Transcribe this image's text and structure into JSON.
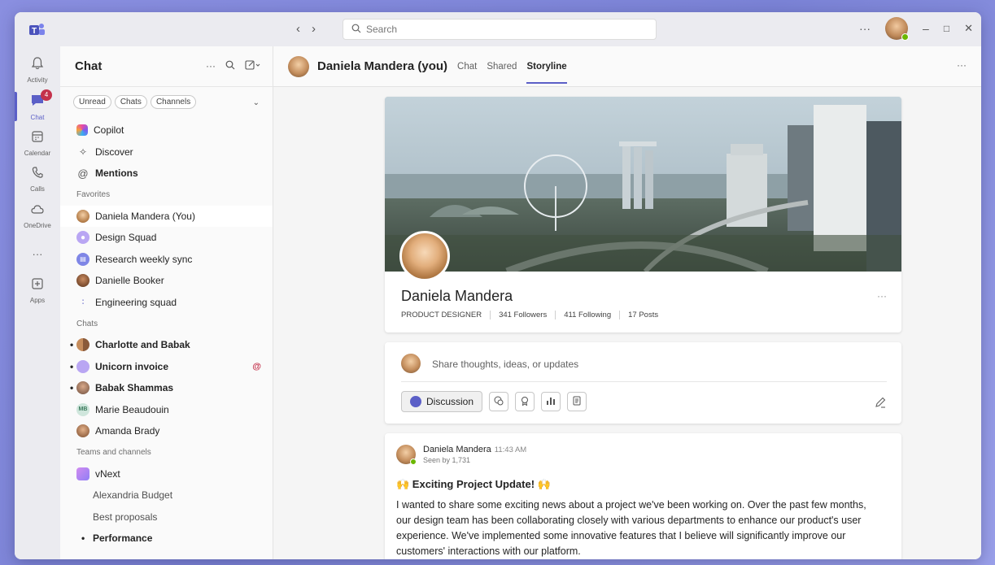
{
  "titlebar": {
    "search_placeholder": "Search",
    "more": "···",
    "minimize": "–",
    "maximize": "□",
    "close": "✕"
  },
  "rail": {
    "items": [
      {
        "label": "Activity",
        "icon": "bell-icon"
      },
      {
        "label": "Chat",
        "icon": "chat-icon",
        "badge": "4"
      },
      {
        "label": "Calendar",
        "icon": "calendar-icon"
      },
      {
        "label": "Calls",
        "icon": "phone-icon"
      },
      {
        "label": "OneDrive",
        "icon": "cloud-icon"
      },
      {
        "label": "",
        "icon": "more-icon"
      },
      {
        "label": "Apps",
        "icon": "apps-icon"
      }
    ]
  },
  "chatpane": {
    "title": "Chat",
    "filters": [
      "Unread",
      "Chats",
      "Channels"
    ],
    "top_items": [
      "Copilot",
      "Discover",
      "Mentions"
    ],
    "favorites_label": "Favorites",
    "favorites": [
      "Daniela Mandera (You)",
      "Design Squad",
      "Research weekly sync",
      "Danielle Booker",
      "Engineering squad"
    ],
    "chats_label": "Chats",
    "chats": [
      "Charlotte and Babak",
      "Unicorn invoice",
      "Babak Shammas",
      "Marie Beaudouin",
      "Amanda Brady"
    ],
    "chat_initials_marie": "MB",
    "mention_symbol": "@",
    "teams_label": "Teams and channels",
    "team": "vNext",
    "channels": [
      "Alexandria Budget",
      "Best proposals",
      "Performance"
    ]
  },
  "main": {
    "name": "Daniela Mandera (you)",
    "tabs": [
      "Chat",
      "Shared",
      "Storyline"
    ],
    "active_tab": "Storyline",
    "more": "···"
  },
  "profile": {
    "name": "Daniela Mandera",
    "role": "PRODUCT DESIGNER",
    "followers": "341 Followers",
    "following": "411 Following",
    "posts": "17 Posts",
    "more": "···"
  },
  "composer": {
    "placeholder": "Share thoughts, ideas, or updates",
    "discussion_label": "Discussion"
  },
  "post": {
    "author": "Daniela Mandera",
    "time": "11:43 AM",
    "seen": "Seen by 1,731",
    "title": "🙌 Exciting Project Update! 🙌",
    "body": "I wanted to share some exciting news about a project we've been working on. Over the past few months, our design team has been collaborating closely with various departments to enhance our product's user experience. We've implemented some innovative features that I believe will significantly improve our customers' interactions with our platform."
  },
  "colors": {
    "brand": "#5b5fc7",
    "presence": "#6bb700",
    "alert": "#c4314b"
  }
}
